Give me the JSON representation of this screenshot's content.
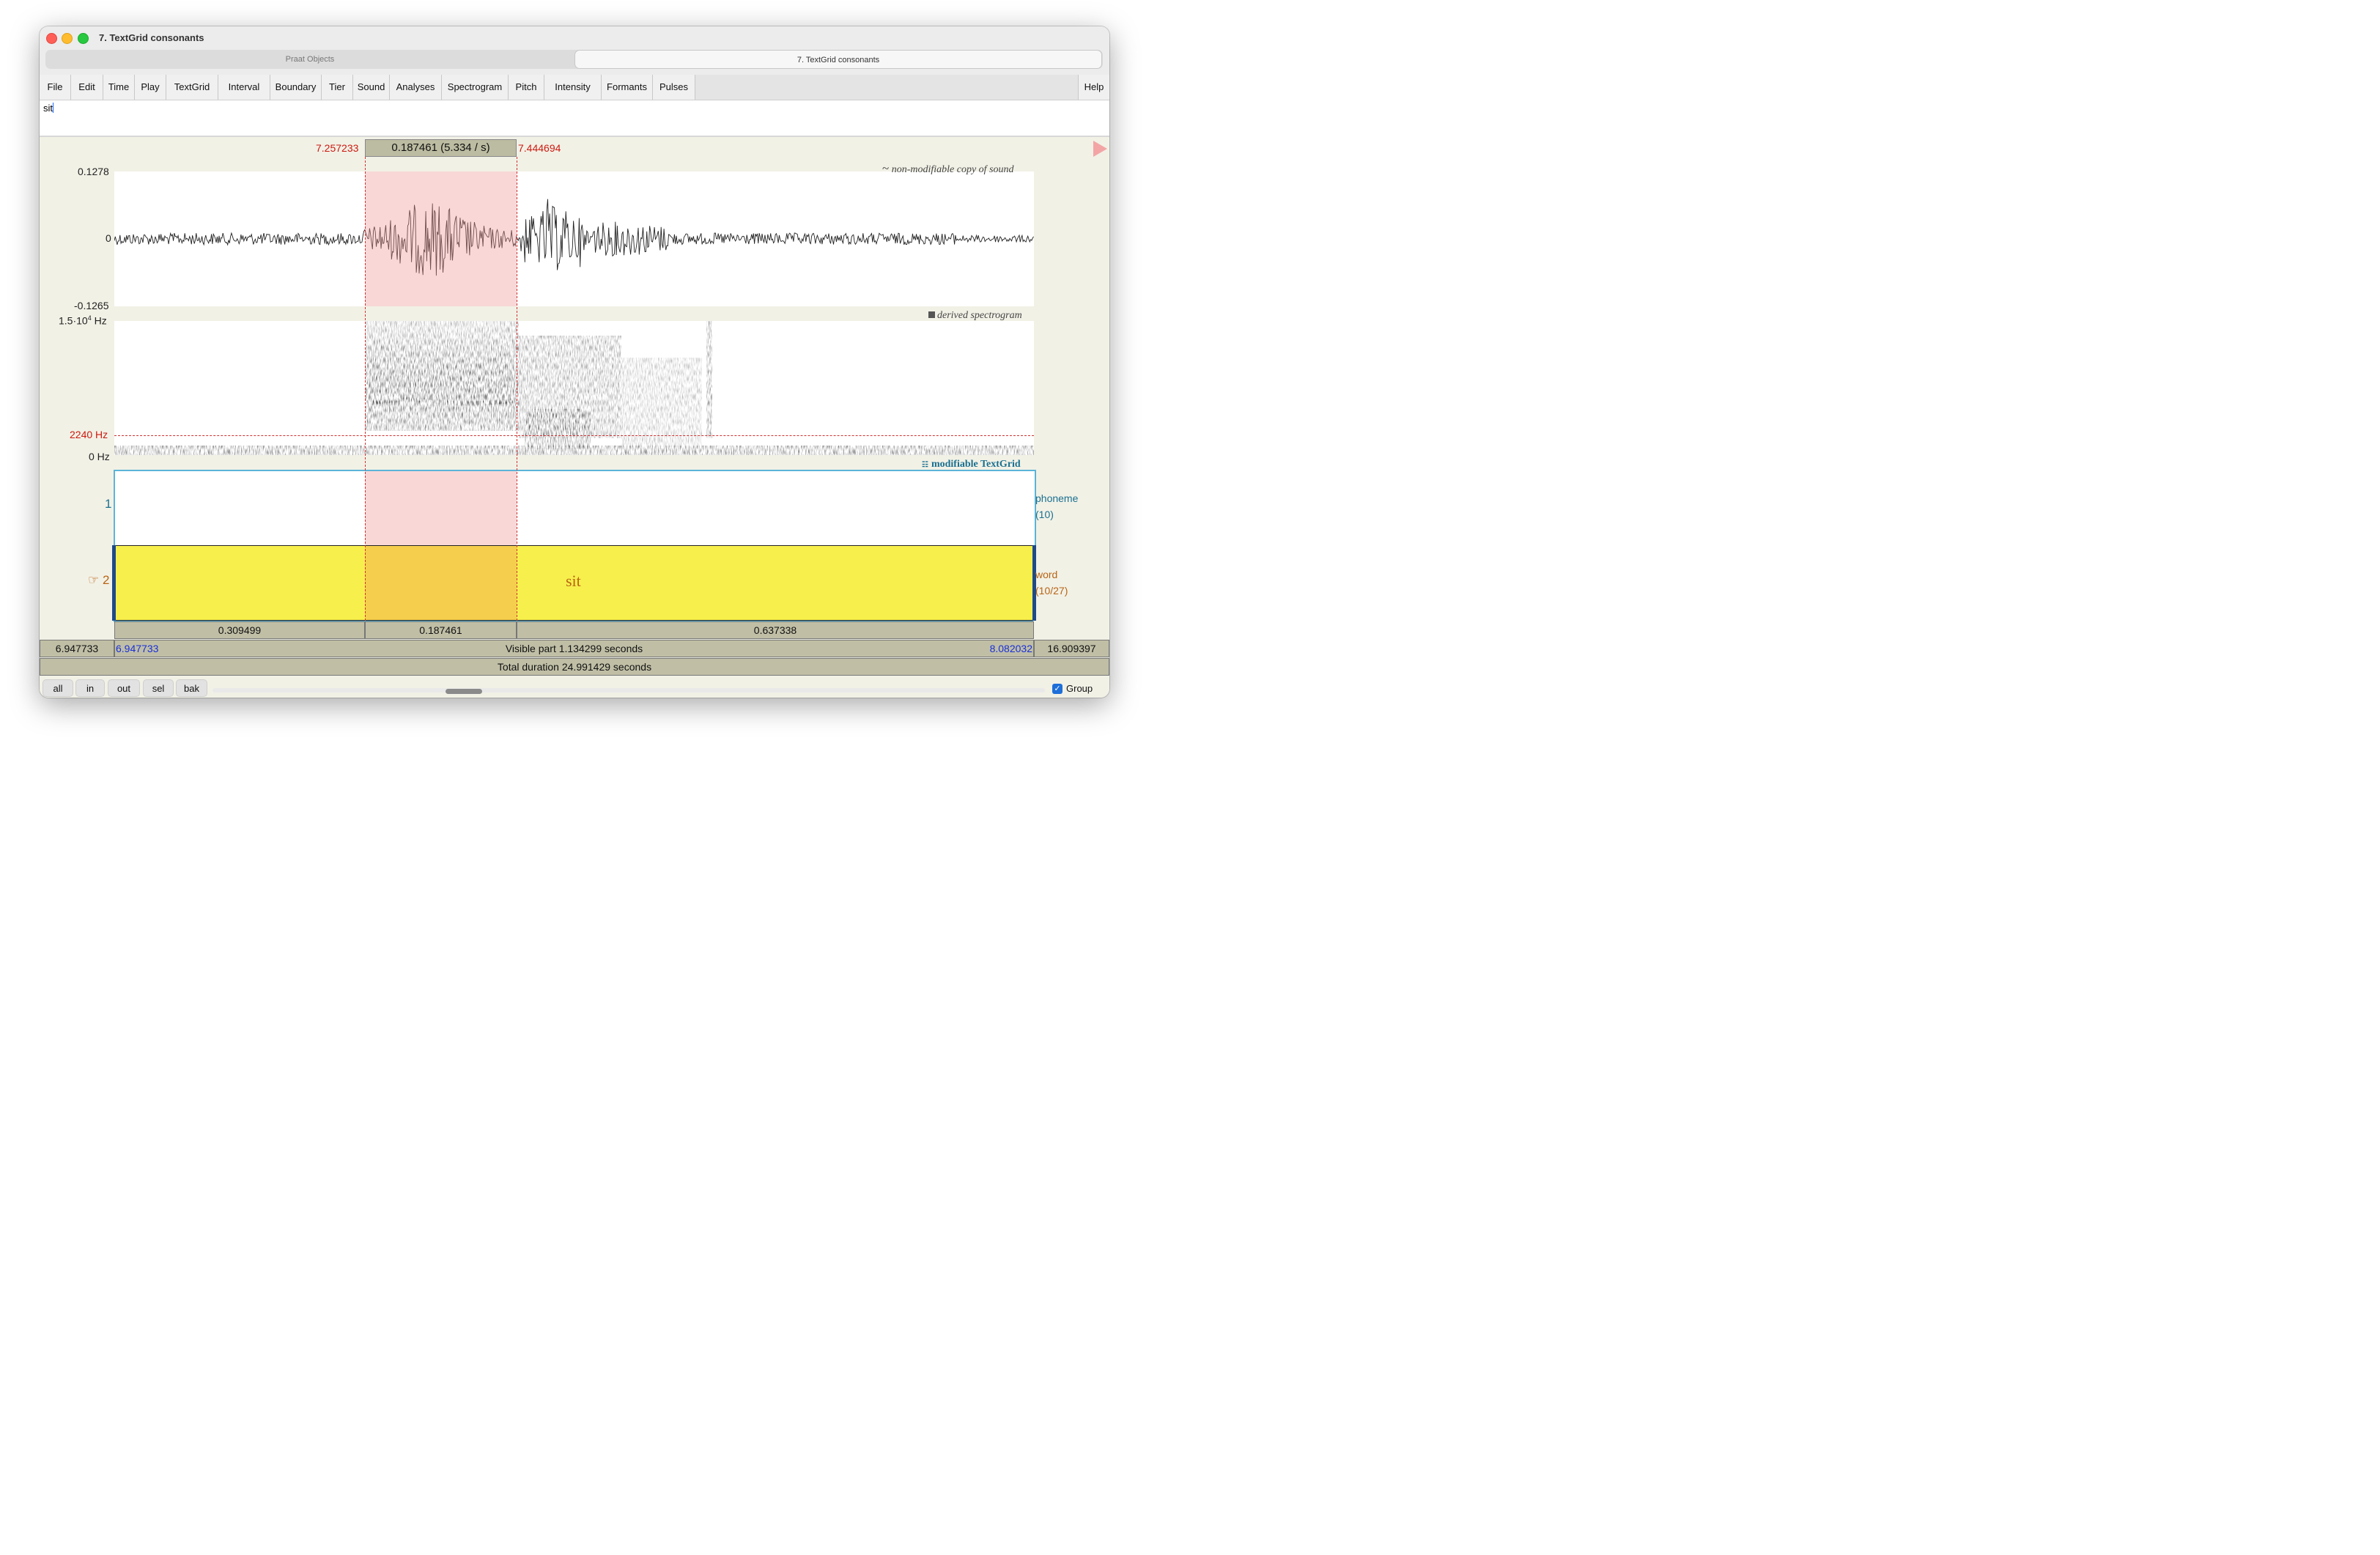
{
  "window": {
    "title": "7. TextGrid consonants",
    "tabs": [
      {
        "label": "Praat Objects",
        "active": false
      },
      {
        "label": "7. TextGrid consonants",
        "active": true
      }
    ]
  },
  "menu": {
    "items": [
      "File",
      "Edit",
      "Time",
      "Play",
      "TextGrid",
      "Interval",
      "Boundary",
      "Tier",
      "Sound",
      "Analyses",
      "Spectrogram",
      "Pitch",
      "Intensity",
      "Formants",
      "Pulses"
    ],
    "help": "Help"
  },
  "text_field": {
    "value": "sit"
  },
  "selection": {
    "start": "7.257233",
    "end": "7.444694",
    "duration_label": "0.187461 (5.334 / s)"
  },
  "waveform": {
    "title": "non-modifiable copy of sound",
    "title_glyph": "~",
    "y_max": "0.1278",
    "y_zero": "0",
    "y_min": "-0.1265"
  },
  "spectrogram": {
    "title": "derived spectrogram",
    "top_label_base": "1.5·10",
    "top_label_exp": "4",
    "top_label_unit": " Hz",
    "cursor_label": "2240 Hz",
    "bottom_label": "0 Hz"
  },
  "textgrid": {
    "title": "modifiable TextGrid",
    "tiers": [
      {
        "number": "1",
        "name": "phoneme",
        "count": "(10)"
      },
      {
        "number": "2",
        "name": "word",
        "count": "(10/27)",
        "hand": "☞"
      }
    ],
    "interval_text": "sit"
  },
  "durations": [
    "0.309499",
    "0.187461",
    "0.637338"
  ],
  "visible": {
    "left_outside": "6.947733",
    "start": "6.947733",
    "label": "Visible part 1.134299 seconds",
    "end": "8.082032",
    "right_outside": "16.909397"
  },
  "total": {
    "label": "Total duration 24.991429 seconds"
  },
  "bottom_buttons": [
    "all",
    "in",
    "out",
    "sel",
    "bak"
  ],
  "group": {
    "label": "Group",
    "checked": true
  },
  "colors": {
    "selection": "#f5d2d2",
    "tier_selected": "#f7f04c",
    "cursor": "#cc1a10",
    "tier_accent": "#1a7090",
    "word_tier": "#b86414"
  }
}
